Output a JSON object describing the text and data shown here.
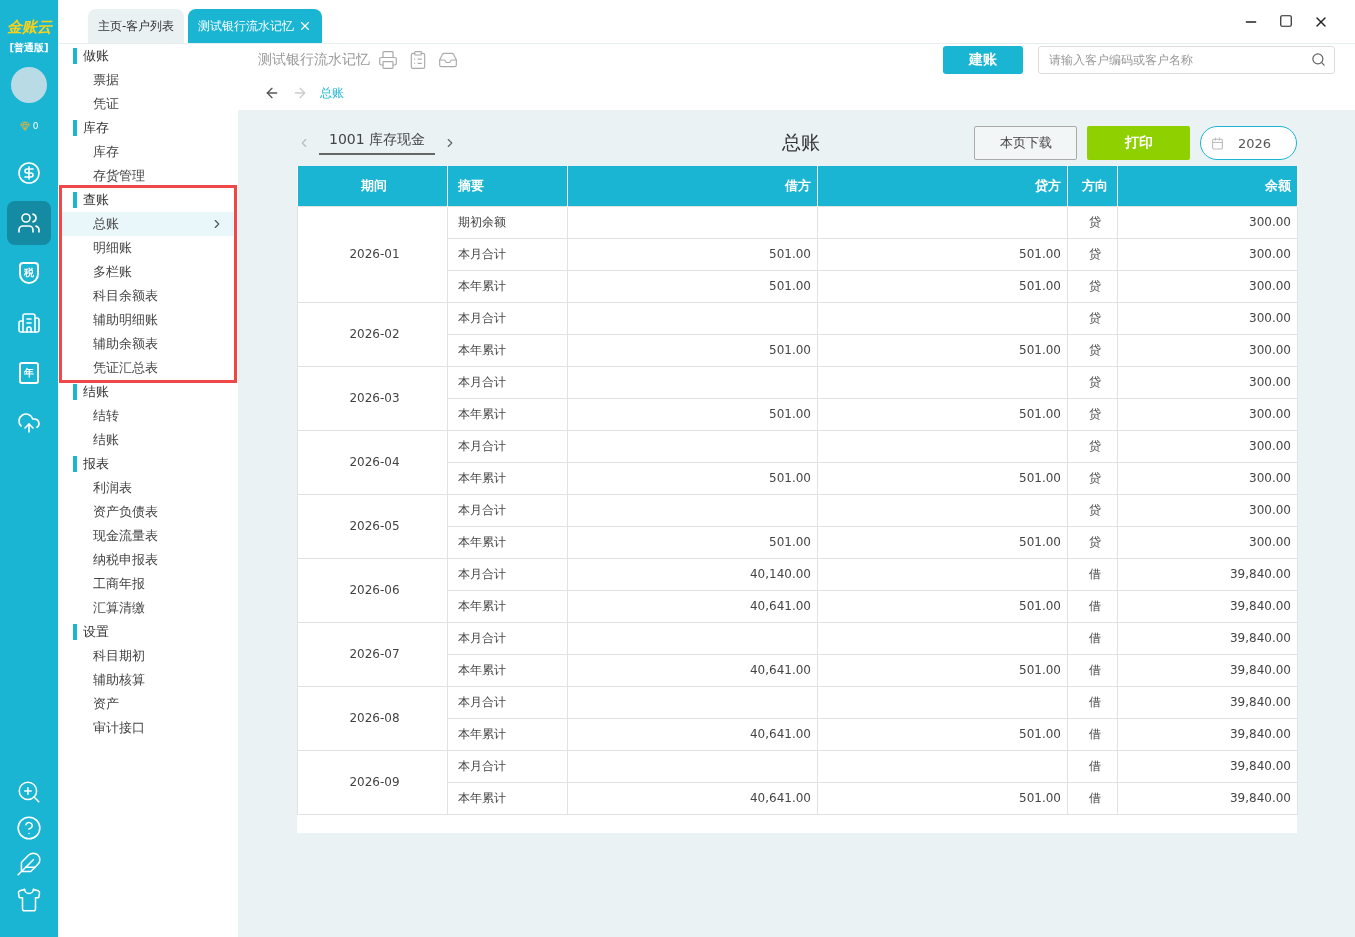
{
  "brand": {
    "logo": "金账云",
    "edition": "[普通版]",
    "points": "0"
  },
  "rail": {
    "items": [
      {
        "kind": "yen",
        "selected": false
      },
      {
        "kind": "users",
        "selected": true
      },
      {
        "kind": "tax",
        "glyph": "税",
        "selected": false
      },
      {
        "kind": "building",
        "selected": false
      },
      {
        "kind": "calendar",
        "glyph": "年",
        "selected": false
      },
      {
        "kind": "cloud",
        "selected": false
      }
    ],
    "bottom": [
      {
        "kind": "zoom"
      },
      {
        "kind": "help"
      },
      {
        "kind": "leaf"
      },
      {
        "kind": "shirt"
      }
    ]
  },
  "tabs": [
    {
      "label": "主页-客户列表",
      "selected": false,
      "closable": false
    },
    {
      "label": "测试银行流水记忆",
      "selected": true,
      "closable": true
    }
  ],
  "sidebar": {
    "sections": [
      {
        "title": "做账",
        "outlined": false,
        "items": [
          {
            "label": "票据",
            "selected": false
          },
          {
            "label": "凭证",
            "selected": false
          }
        ]
      },
      {
        "title": "库存",
        "outlined": false,
        "items": [
          {
            "label": "库存",
            "selected": false
          },
          {
            "label": "存货管理",
            "selected": false
          }
        ]
      },
      {
        "title": "查账",
        "outlined": true,
        "items": [
          {
            "label": "总账",
            "selected": true
          },
          {
            "label": "明细账",
            "selected": false
          },
          {
            "label": "多栏账",
            "selected": false
          },
          {
            "label": "科目余额表",
            "selected": false
          },
          {
            "label": "辅助明细账",
            "selected": false
          },
          {
            "label": "辅助余额表",
            "selected": false
          },
          {
            "label": "凭证汇总表",
            "selected": false
          }
        ]
      },
      {
        "title": "结账",
        "outlined": false,
        "items": [
          {
            "label": "结转",
            "selected": false
          },
          {
            "label": "结账",
            "selected": false
          }
        ]
      },
      {
        "title": "报表",
        "outlined": false,
        "items": [
          {
            "label": "利润表",
            "selected": false
          },
          {
            "label": "资产负债表",
            "selected": false
          },
          {
            "label": "现金流量表",
            "selected": false
          },
          {
            "label": "纳税申报表",
            "selected": false
          },
          {
            "label": "工商年报",
            "selected": false
          },
          {
            "label": "汇算清缴",
            "selected": false
          }
        ]
      },
      {
        "title": "设置",
        "outlined": false,
        "items": [
          {
            "label": "科目期初",
            "selected": false
          },
          {
            "label": "辅助核算",
            "selected": false
          },
          {
            "label": "资产",
            "selected": false
          },
          {
            "label": "审计接口",
            "selected": false
          }
        ]
      }
    ]
  },
  "header": {
    "company": "测试银行流水记忆",
    "create_button": "建账",
    "search": {
      "placeholder": "请输入客户编码或客户名称"
    },
    "breadcrumb": "总账"
  },
  "report": {
    "account": "1001 库存现金",
    "title": "总账",
    "download_button": "本页下载",
    "print_button": "打印",
    "year": "2026"
  },
  "table": {
    "columns": [
      "期间",
      "摘要",
      "借方",
      "贷方",
      "方向",
      "余额"
    ],
    "groups": [
      {
        "period": "2026-01",
        "rows": [
          {
            "summary": "期初余额",
            "direction": "贷",
            "balance": "300.00"
          },
          {
            "summary": "本月合计",
            "debit": "501.00",
            "credit": "501.00",
            "direction": "贷",
            "balance": "300.00"
          },
          {
            "summary": "本年累计",
            "debit": "501.00",
            "credit": "501.00",
            "direction": "贷",
            "balance": "300.00"
          }
        ]
      },
      {
        "period": "2026-02",
        "rows": [
          {
            "summary": "本月合计",
            "direction": "贷",
            "balance": "300.00"
          },
          {
            "summary": "本年累计",
            "debit": "501.00",
            "credit": "501.00",
            "direction": "贷",
            "balance": "300.00"
          }
        ]
      },
      {
        "period": "2026-03",
        "rows": [
          {
            "summary": "本月合计",
            "direction": "贷",
            "balance": "300.00"
          },
          {
            "summary": "本年累计",
            "debit": "501.00",
            "credit": "501.00",
            "direction": "贷",
            "balance": "300.00"
          }
        ]
      },
      {
        "period": "2026-04",
        "rows": [
          {
            "summary": "本月合计",
            "direction": "贷",
            "balance": "300.00"
          },
          {
            "summary": "本年累计",
            "debit": "501.00",
            "credit": "501.00",
            "direction": "贷",
            "balance": "300.00"
          }
        ]
      },
      {
        "period": "2026-05",
        "rows": [
          {
            "summary": "本月合计",
            "direction": "贷",
            "balance": "300.00"
          },
          {
            "summary": "本年累计",
            "debit": "501.00",
            "credit": "501.00",
            "direction": "贷",
            "balance": "300.00"
          }
        ]
      },
      {
        "period": "2026-06",
        "rows": [
          {
            "summary": "本月合计",
            "debit": "40,140.00",
            "direction": "借",
            "balance": "39,840.00"
          },
          {
            "summary": "本年累计",
            "debit": "40,641.00",
            "credit": "501.00",
            "direction": "借",
            "balance": "39,840.00"
          }
        ]
      },
      {
        "period": "2026-07",
        "rows": [
          {
            "summary": "本月合计",
            "direction": "借",
            "balance": "39,840.00"
          },
          {
            "summary": "本年累计",
            "debit": "40,641.00",
            "credit": "501.00",
            "direction": "借",
            "balance": "39,840.00"
          }
        ]
      },
      {
        "period": "2026-08",
        "rows": [
          {
            "summary": "本月合计",
            "direction": "借",
            "balance": "39,840.00"
          },
          {
            "summary": "本年累计",
            "debit": "40,641.00",
            "credit": "501.00",
            "direction": "借",
            "balance": "39,840.00"
          }
        ]
      },
      {
        "period": "2026-09",
        "rows": [
          {
            "summary": "本月合计",
            "direction": "借",
            "balance": "39,840.00"
          },
          {
            "summary": "本年累计",
            "debit": "40,641.00",
            "credit": "501.00",
            "direction": "借",
            "balance": "39,840.00"
          }
        ]
      }
    ]
  }
}
